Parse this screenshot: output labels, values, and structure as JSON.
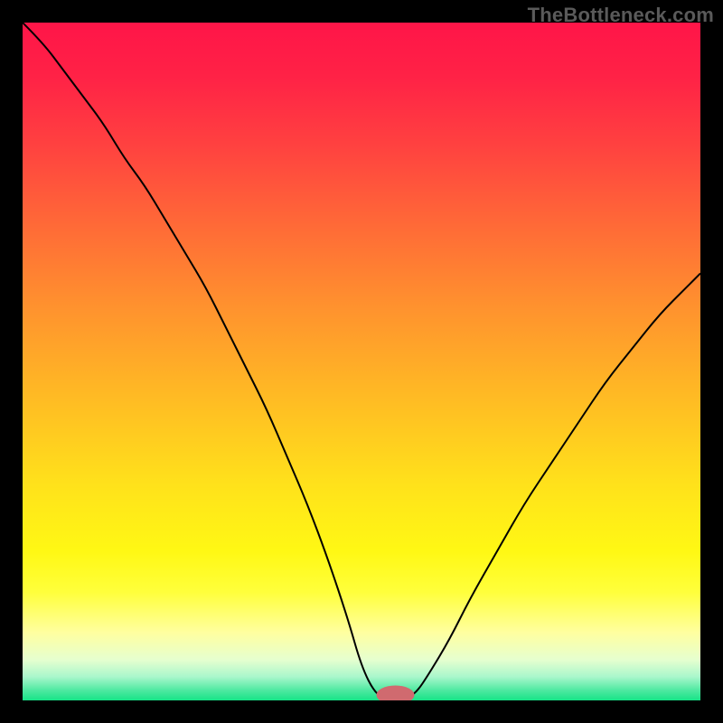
{
  "watermark": "TheBottleneck.com",
  "chart_data": {
    "type": "line",
    "title": "",
    "xlabel": "",
    "ylabel": "",
    "xlim": [
      0,
      100
    ],
    "ylim": [
      0,
      100
    ],
    "background_gradient_stops": [
      {
        "offset": 0.0,
        "color": "#ff1548"
      },
      {
        "offset": 0.08,
        "color": "#ff2246"
      },
      {
        "offset": 0.18,
        "color": "#ff4140"
      },
      {
        "offset": 0.3,
        "color": "#ff6a37"
      },
      {
        "offset": 0.42,
        "color": "#ff922e"
      },
      {
        "offset": 0.55,
        "color": "#ffba24"
      },
      {
        "offset": 0.68,
        "color": "#ffe11b"
      },
      {
        "offset": 0.78,
        "color": "#fff814"
      },
      {
        "offset": 0.84,
        "color": "#ffff3b"
      },
      {
        "offset": 0.9,
        "color": "#ffffa0"
      },
      {
        "offset": 0.94,
        "color": "#e6ffcf"
      },
      {
        "offset": 0.965,
        "color": "#aaf7cc"
      },
      {
        "offset": 0.985,
        "color": "#4fe9a1"
      },
      {
        "offset": 1.0,
        "color": "#17e387"
      }
    ],
    "series": [
      {
        "name": "bottleneck-curve",
        "color": "#000000",
        "x": [
          0,
          3,
          6,
          9,
          12,
          15,
          18,
          21,
          24,
          27,
          30,
          33,
          36,
          39,
          42,
          45,
          48,
          50,
          52,
          54,
          56,
          58,
          60,
          63,
          66,
          70,
          74,
          78,
          82,
          86,
          90,
          94,
          98,
          100
        ],
        "values": [
          100,
          97,
          93,
          89,
          85,
          80,
          76,
          71,
          66,
          61,
          55,
          49,
          43,
          36,
          29,
          21,
          12,
          5,
          1,
          0,
          0,
          1,
          4,
          9,
          15,
          22,
          29,
          35,
          41,
          47,
          52,
          57,
          61,
          63
        ]
      }
    ],
    "marker": {
      "name": "optimal-point",
      "x": 55,
      "y": 0.8,
      "color": "#d06a6f",
      "rx": 2.8,
      "ry": 1.4
    }
  }
}
